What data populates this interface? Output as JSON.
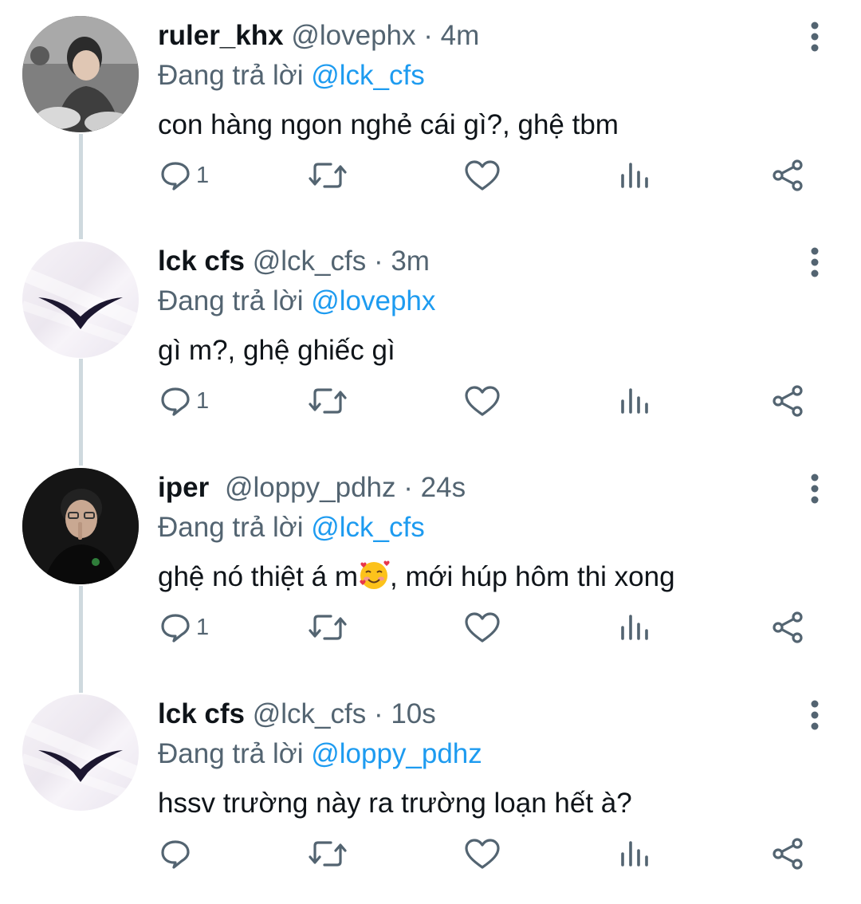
{
  "colors": {
    "text": "#0f1419",
    "secondary": "#536471",
    "mention": "#1d9bf0",
    "thread_line": "#cfd9de"
  },
  "tweets": [
    {
      "name": "ruler_khx",
      "handle": "@lovephx",
      "sep": "·",
      "time": "4m",
      "reply_prefix": "Đang trả lời",
      "reply_to": "@lck_cfs",
      "text": "con hàng ngon nghẻ cái gì?, ghệ tbm",
      "reply_count": "1",
      "avatar_icon": "user-photo-avatar"
    },
    {
      "name": "lck cfs",
      "handle": "@lck_cfs",
      "sep": "·",
      "time": "3m",
      "reply_prefix": "Đang trả lời",
      "reply_to": "@lovephx",
      "text": "gì m?, ghệ ghiếc gì",
      "reply_count": "1",
      "avatar_icon": "wing-logo-avatar"
    },
    {
      "name": "iper",
      "handle": "@loppy_pdhz",
      "sep": "·",
      "time": "24s",
      "reply_prefix": "Đang trả lời",
      "reply_to": "@lck_cfs",
      "text_before": "ghệ nó thiệt á m",
      "emoji_icon": "smiling-face-with-hearts-emoji",
      "text_after": ", mới húp hôm thi xong",
      "reply_count": "1",
      "avatar_icon": "user-photo-avatar"
    },
    {
      "name": "lck cfs",
      "handle": "@lck_cfs",
      "sep": "·",
      "time": "10s",
      "reply_prefix": "Đang trả lời",
      "reply_to": "@loppy_pdhz",
      "text": "hssv trường này ra trường loạn hết à?",
      "reply_count": "",
      "avatar_icon": "wing-logo-avatar"
    }
  ],
  "action_icons": [
    "reply-icon",
    "retweet-icon",
    "like-icon",
    "views-icon",
    "share-icon"
  ]
}
